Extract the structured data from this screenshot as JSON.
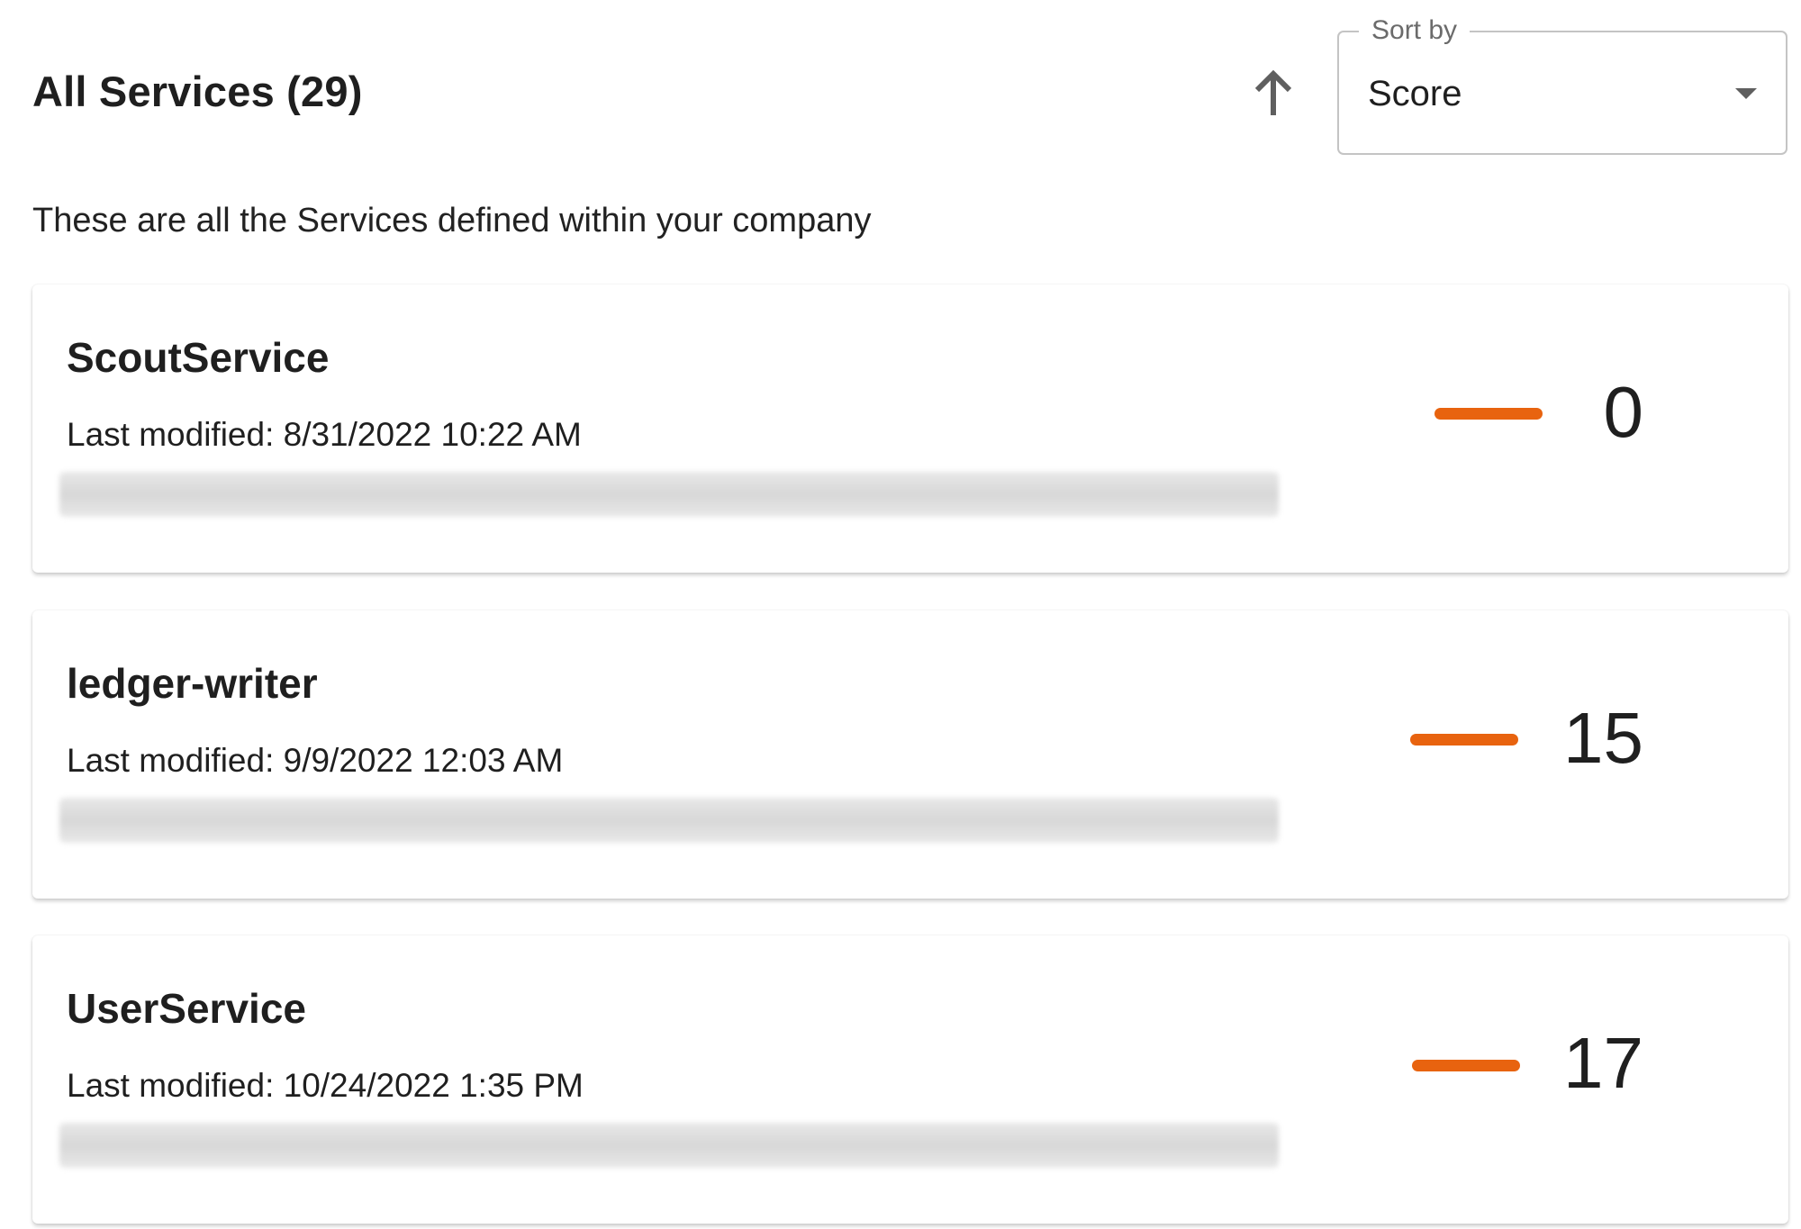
{
  "header": {
    "title": "All Services (29)",
    "subtitle": "These are all the Services defined within your company"
  },
  "sort": {
    "label": "Sort by",
    "value": "Score",
    "direction": "ascending",
    "direction_icon": "arrow-up-icon",
    "dropdown_icon": "caret-down-icon"
  },
  "colors": {
    "score_indicator": "#e8630f",
    "text_primary": "#1f1f1f",
    "border": "#c4c4c4"
  },
  "services": [
    {
      "name": "ScoutService",
      "modified": "Last modified: 8/31/2022 10:22 AM",
      "score": "0",
      "trend_icon": "flat-dash-icon"
    },
    {
      "name": "ledger-writer",
      "modified": "Last modified: 9/9/2022 12:03 AM",
      "score": "15",
      "trend_icon": "flat-dash-icon"
    },
    {
      "name": "UserService",
      "modified": "Last modified: 10/24/2022 1:35 PM",
      "score": "17",
      "trend_icon": "flat-dash-icon"
    }
  ]
}
